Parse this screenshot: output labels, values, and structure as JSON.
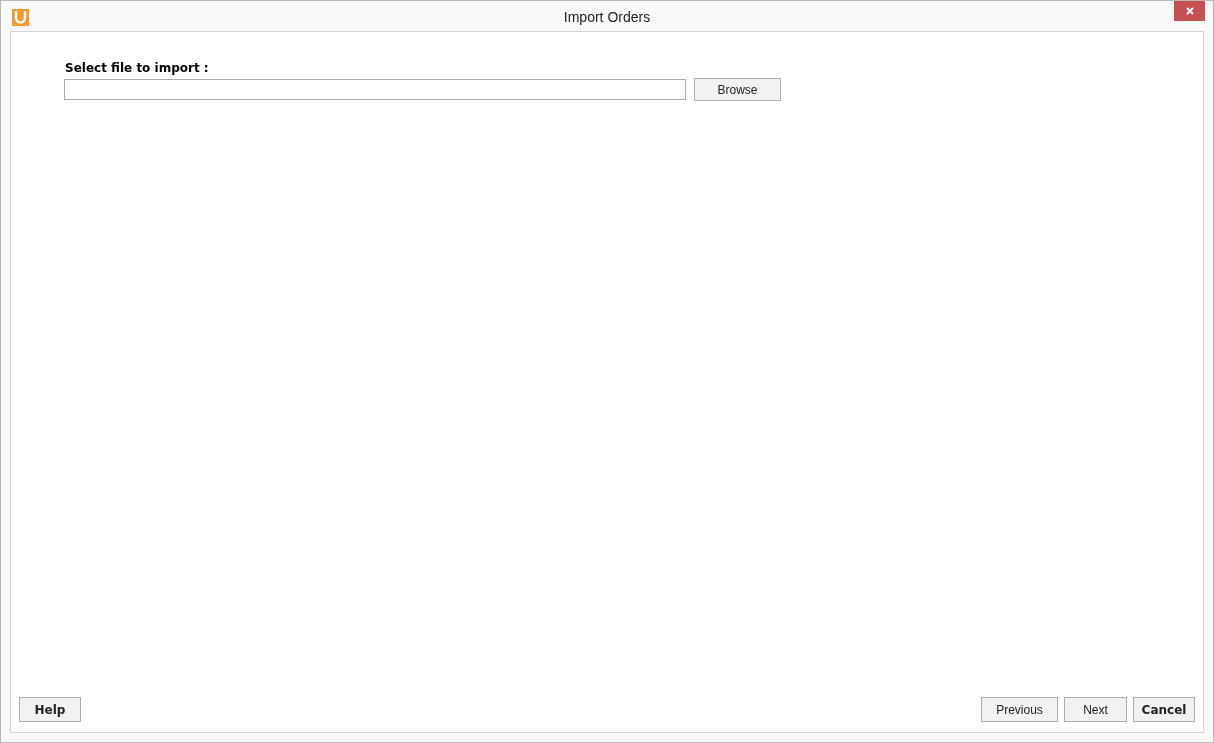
{
  "window": {
    "title": "Import Orders"
  },
  "file_select": {
    "label": "Select file to import :",
    "button": "Browse"
  },
  "footer_left": [
    {
      "label": "Help",
      "kind": "bold"
    }
  ],
  "footer_right": [
    {
      "label": "Previous",
      "kind": "normal"
    },
    {
      "label": "Next",
      "kind": "normal"
    },
    {
      "label": "Cancel",
      "kind": "bold"
    }
  ]
}
